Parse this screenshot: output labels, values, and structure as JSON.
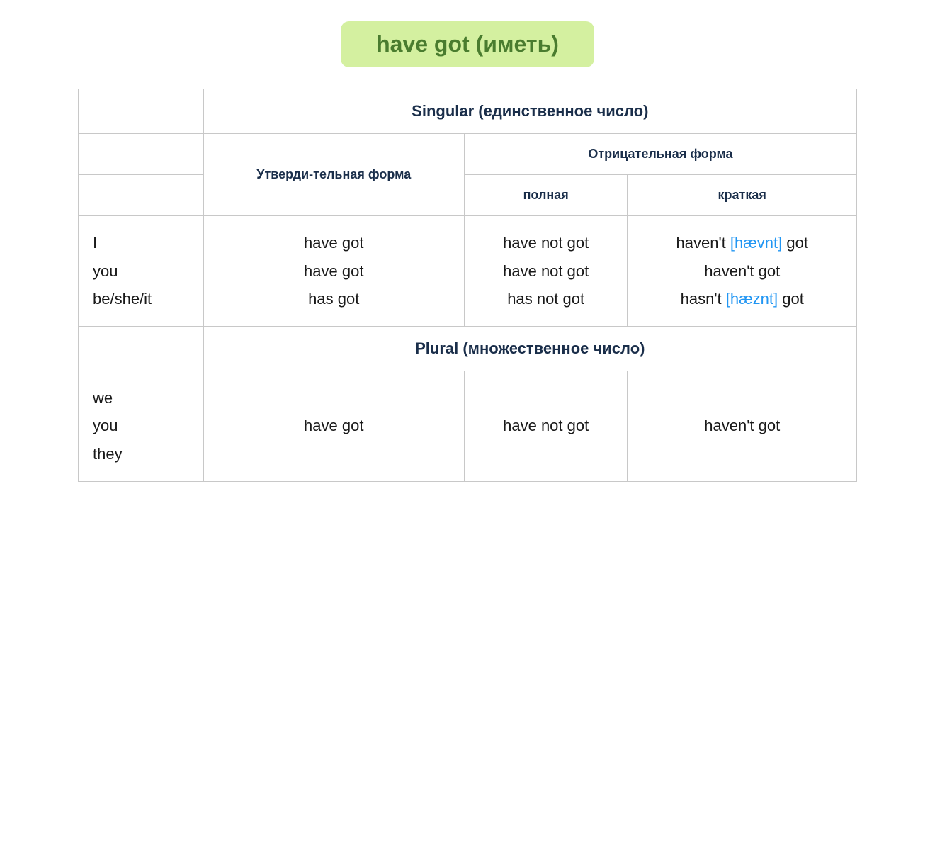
{
  "title": "have got (иметь)",
  "table": {
    "singular_label": "Singular (единственное число)",
    "plural_label": "Plural (множественное число)",
    "col_affirmative": "Утверди-тельная форма",
    "col_negative": "Отрицательная форма",
    "col_full": "полная",
    "col_short": "краткая",
    "singular_rows": [
      {
        "pronoun": "I\nyou\nbe/she/it",
        "affirmative": "have got\nhave got\nhas got",
        "negative_full": "have not got\nhave not got\nhas not got",
        "negative_short_parts": [
          {
            "text": "haven't ",
            "phonetic": "[hævnt]",
            "rest": " got"
          },
          {
            "text": "haven't got",
            "phonetic": null,
            "rest": null
          },
          {
            "text": "hasn't ",
            "phonetic": "[hæznt]",
            "rest": " got"
          }
        ]
      }
    ],
    "plural_rows": [
      {
        "pronoun": "we\nyou\nthey",
        "affirmative": "have got",
        "negative_full": "have not got",
        "negative_short": "haven't got"
      }
    ]
  }
}
